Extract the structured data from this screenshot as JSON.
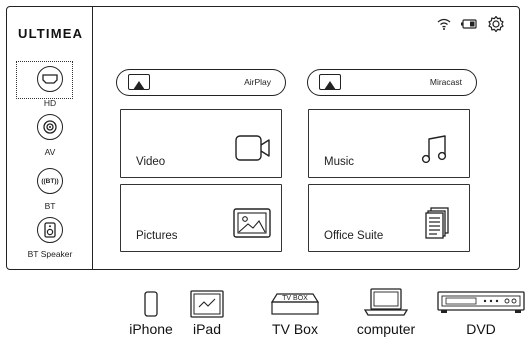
{
  "brand": "ULTIMEA",
  "sources": [
    {
      "name": "hd",
      "label": "HD",
      "icon": "hdmi-icon",
      "selected": true
    },
    {
      "name": "av",
      "label": "AV",
      "icon": "av-icon"
    },
    {
      "name": "bt",
      "label": "BT",
      "icon": "bluetooth-icon",
      "icon_text": "((BT))"
    },
    {
      "name": "bt-speaker",
      "label": "BT Speaker",
      "icon": "speaker-icon"
    }
  ],
  "status_icons": [
    "wifi-icon",
    "battery-icon",
    "gear-icon"
  ],
  "cast": [
    {
      "label": "AirPlay",
      "icon": "airplay-icon"
    },
    {
      "label": "Miracast",
      "icon": "miracast-icon"
    }
  ],
  "tiles": [
    {
      "label": "Video",
      "icon": "video-camera-icon"
    },
    {
      "label": "Music",
      "icon": "music-note-icon"
    },
    {
      "label": "Pictures",
      "icon": "picture-icon"
    },
    {
      "label": "Office Suite",
      "icon": "document-icon"
    }
  ],
  "devices": [
    {
      "label": "iPhone",
      "icon": "iphone-icon"
    },
    {
      "label": "iPad",
      "icon": "ipad-icon"
    },
    {
      "label": "TV Box",
      "icon": "tv-box-icon",
      "icon_text": "TV BOX"
    },
    {
      "label": "computer",
      "icon": "laptop-icon"
    },
    {
      "label": "DVD",
      "icon": "dvd-player-icon"
    }
  ],
  "colors": {
    "line": "#222222",
    "background": "#ffffff"
  }
}
